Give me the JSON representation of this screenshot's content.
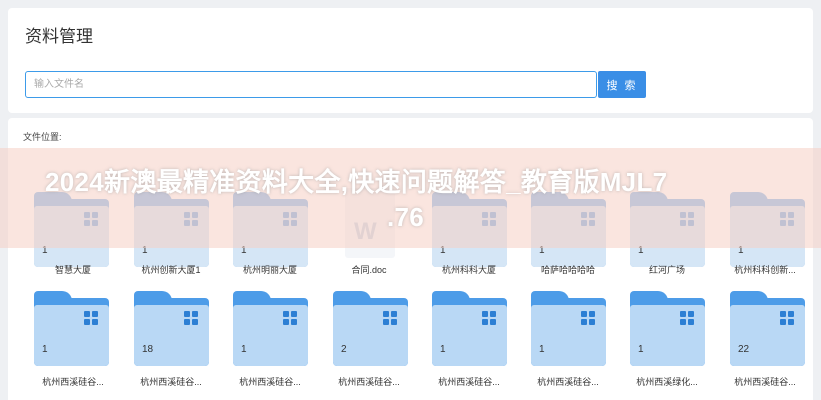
{
  "header": {
    "title": "资料管理",
    "search_placeholder": "输入文件名",
    "search_button": "搜 索"
  },
  "main": {
    "location_label": "文件位置:",
    "row1": [
      {
        "name": "智慧大厦",
        "count": "1"
      },
      {
        "name": "杭州创新大厦1",
        "count": "1"
      },
      {
        "name": "杭州明丽大厦",
        "count": "1"
      },
      {
        "name": "合同.doc",
        "type": "doc"
      },
      {
        "name": "杭州科科大厦",
        "count": "1"
      },
      {
        "name": "哈萨哈哈哈哈",
        "count": "1"
      },
      {
        "name": "红河广场",
        "count": "1"
      },
      {
        "name": "杭州科科创新...",
        "count": "1"
      }
    ],
    "row2": [
      {
        "name": "杭州西溪硅谷...",
        "count": "1"
      },
      {
        "name": "杭州西溪硅谷...",
        "count": "18"
      },
      {
        "name": "杭州西溪硅谷...",
        "count": "1"
      },
      {
        "name": "杭州西溪硅谷...",
        "count": "2"
      },
      {
        "name": "杭州西溪硅谷...",
        "count": "1"
      },
      {
        "name": "杭州西溪硅谷...",
        "count": "1"
      },
      {
        "name": "杭州西溪绿化...",
        "count": "1"
      },
      {
        "name": "杭州西溪硅谷...",
        "count": "22"
      }
    ]
  },
  "overlay": {
    "title_line1": "2024新澳最精准资料大全,快速问题解答_教育版MJL7",
    "title_line2": ".76"
  },
  "colors": {
    "accent": "#3a8ee6",
    "folder": "#4d9ce8",
    "folder_front": "#b9d8f5"
  }
}
